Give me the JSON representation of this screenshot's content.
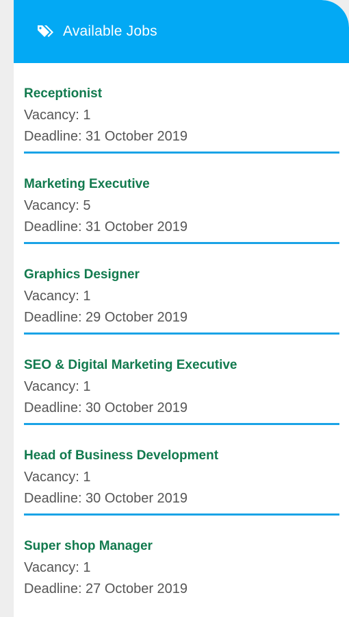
{
  "header": {
    "title": "Available Jobs",
    "icon": "tags-icon"
  },
  "colors": {
    "header_bg": "#03a9f4",
    "job_title": "#127a4e",
    "divider": "#1aa3e6"
  },
  "jobs": [
    {
      "title": "Receptionist",
      "vacancy": "Vacancy: 1",
      "deadline": "Deadline: 31 October 2019"
    },
    {
      "title": "Marketing Executive",
      "vacancy": "Vacancy: 5",
      "deadline": "Deadline: 31 October 2019"
    },
    {
      "title": "Graphics Designer",
      "vacancy": "Vacancy: 1",
      "deadline": "Deadline: 29 October 2019"
    },
    {
      "title": "SEO & Digital Marketing Executive",
      "vacancy": "Vacancy: 1",
      "deadline": "Deadline: 30 October 2019"
    },
    {
      "title": "Head of Business Development",
      "vacancy": "Vacancy: 1",
      "deadline": "Deadline: 30 October 2019"
    },
    {
      "title": "Super shop Manager",
      "vacancy": "Vacancy: 1",
      "deadline": "Deadline: 27 October 2019"
    }
  ]
}
